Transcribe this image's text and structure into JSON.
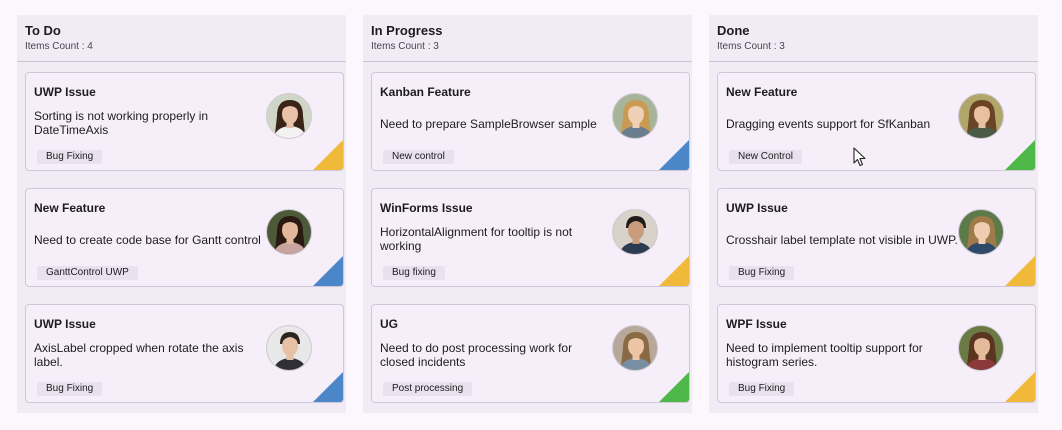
{
  "colors": {
    "orange": "#f0b93a",
    "blue": "#4a86c8",
    "green": "#4eb849"
  },
  "columns": [
    {
      "title": "To Do",
      "count": "Items Count : 4",
      "cards": [
        {
          "title": "UWP Issue",
          "desc": "Sorting is not working properly in DateTimeAxis",
          "tag": "Bug Fixing",
          "priority": "orange",
          "avatar": "woman-dark-hair"
        },
        {
          "title": "New Feature",
          "desc": "Need to create code base for Gantt control",
          "tag": "GanttControl UWP",
          "priority": "blue",
          "avatar": "woman-dark-hair-2"
        },
        {
          "title": "UWP Issue",
          "desc": "AxisLabel cropped when rotate the axis label.",
          "tag": "Bug Fixing",
          "priority": "blue",
          "avatar": "man-dark-hair"
        }
      ]
    },
    {
      "title": "In Progress",
      "count": "Items Count : 3",
      "cards": [
        {
          "title": "Kanban Feature",
          "desc": "Need to prepare SampleBrowser sample",
          "tag": "New control",
          "priority": "blue",
          "avatar": "woman-blonde"
        },
        {
          "title": "WinForms Issue",
          "desc": "HorizontalAlignment for tooltip is not working",
          "tag": "Bug fixing",
          "priority": "orange",
          "avatar": "man-suit"
        },
        {
          "title": "UG",
          "desc": "Need to do post processing work for closed incidents",
          "tag": "Post processing",
          "priority": "green",
          "avatar": "woman-smiling"
        }
      ]
    },
    {
      "title": "Done",
      "count": "Items Count : 3",
      "cards": [
        {
          "title": "New Feature",
          "desc": "Dragging events support for SfKanban",
          "tag": "New Control",
          "priority": "green",
          "avatar": "woman-brown-hair"
        },
        {
          "title": "UWP Issue",
          "desc": "Crosshair label template not visible in UWP.",
          "tag": "Bug Fixing",
          "priority": "orange",
          "avatar": "woman-light-hair"
        },
        {
          "title": "WPF Issue",
          "desc": "Need to implement tooltip support for histogram series.",
          "tag": "Bug Fixing",
          "priority": "orange",
          "avatar": "woman-curly-hair"
        }
      ]
    }
  ]
}
